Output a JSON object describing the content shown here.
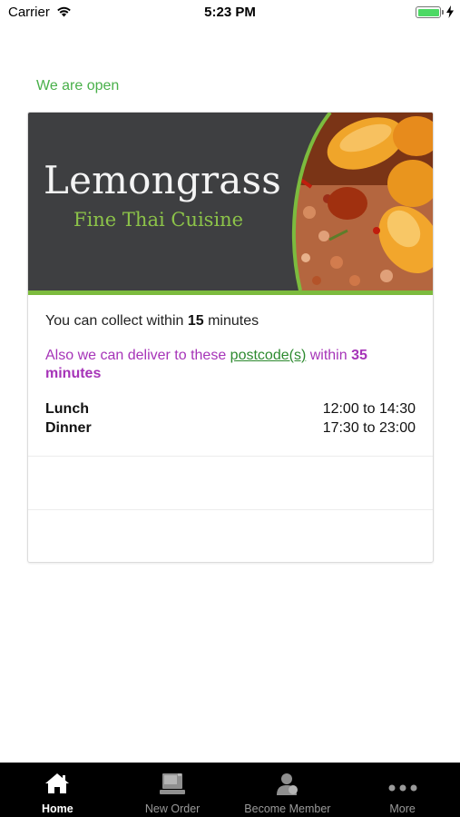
{
  "status_bar": {
    "carrier": "Carrier",
    "time": "5:23 PM"
  },
  "open_status": "We are open",
  "restaurant": {
    "name": "Lemongrass",
    "tagline": "Fine Thai Cuisine"
  },
  "collection": {
    "prefix": "You can collect within ",
    "minutes": "15",
    "suffix": " minutes"
  },
  "delivery": {
    "prefix": "Also we can deliver to these ",
    "link": "postcode(s)",
    "middle": " within ",
    "minutes": "35",
    "suffix": "minutes"
  },
  "hours": [
    {
      "label": "Lunch",
      "time": "12:00 to 14:30"
    },
    {
      "label": "Dinner",
      "time": "17:30 to 23:00"
    }
  ],
  "tabs": [
    {
      "label": "Home",
      "icon": "home-icon",
      "active": true
    },
    {
      "label": "New Order",
      "icon": "new-order-icon",
      "active": false
    },
    {
      "label": "Become Member",
      "icon": "member-icon",
      "active": false
    },
    {
      "label": "More",
      "icon": "more-icon",
      "active": false
    }
  ],
  "colors": {
    "open_green": "#49b04a",
    "accent_purple": "#a634b8",
    "link_green": "#2d8a2f",
    "banner_dark": "#3e3f41",
    "brand_green": "#8cc349",
    "tab_bar": "#000000"
  }
}
